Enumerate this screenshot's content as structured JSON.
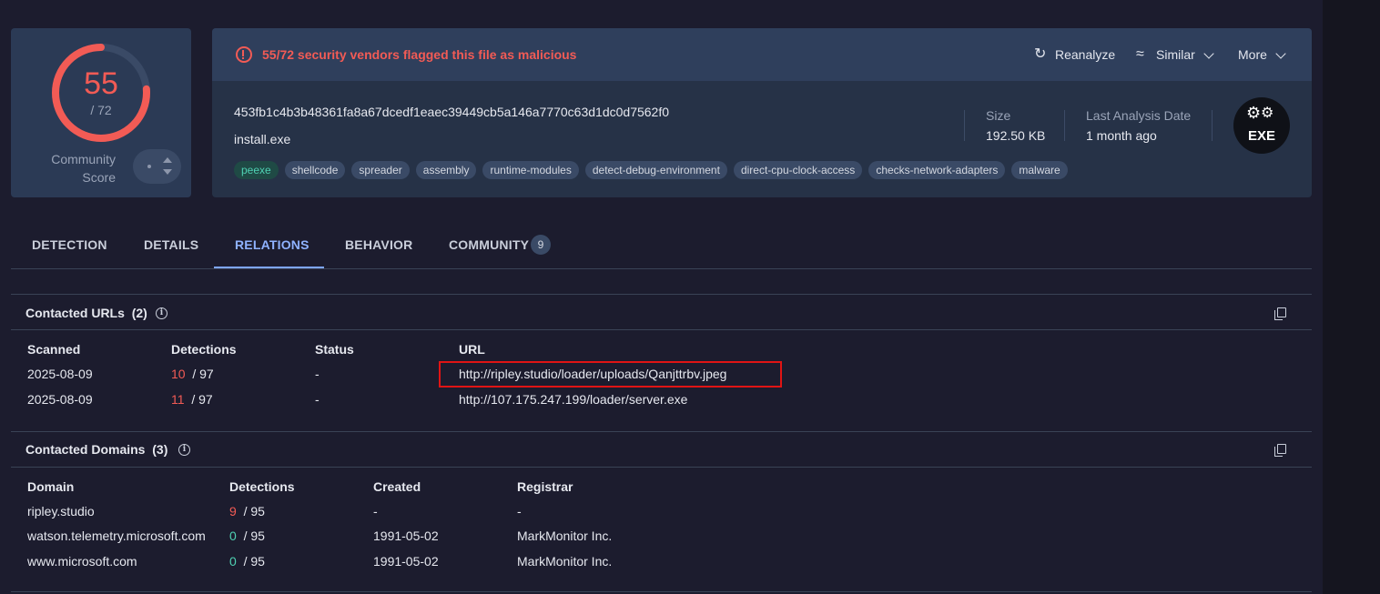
{
  "score": {
    "value": "55",
    "total": "/ 72",
    "fraction": 0.764,
    "community_label_line1": "Community",
    "community_label_line2": "Score",
    "vote_value": "-"
  },
  "alert": {
    "icon": "alert-circle-icon",
    "text": "55/72 security vendors flagged this file as malicious"
  },
  "actions": {
    "reanalyze": "Reanalyze",
    "similar": "Similar",
    "more": "More"
  },
  "file": {
    "hash": "453fb1c4b3b48361fa8a67dcedf1eaec39449cb5a146a7770c63d1dc0d7562f0",
    "name": "install.exe",
    "tags": [
      "peexe",
      "shellcode",
      "spreader",
      "assembly",
      "runtime-modules",
      "detect-debug-environment",
      "direct-cpu-clock-access",
      "checks-network-adapters",
      "malware"
    ],
    "size_label": "Size",
    "size_value": "192.50 KB",
    "date_label": "Last Analysis Date",
    "date_value": "1 month ago",
    "type_badge": "EXE"
  },
  "tabs": [
    {
      "label": "DETECTION",
      "active": false
    },
    {
      "label": "DETAILS",
      "active": false
    },
    {
      "label": "RELATIONS",
      "active": true
    },
    {
      "label": "BEHAVIOR",
      "active": false
    },
    {
      "label": "COMMUNITY",
      "active": false,
      "badge": "9"
    }
  ],
  "contacted_urls": {
    "title": "Contacted URLs",
    "count": "(2)",
    "headers": [
      "Scanned",
      "Detections",
      "Status",
      "URL"
    ],
    "rows": [
      {
        "scanned": "2025-08-09",
        "det": "10",
        "det_total": "/ 97",
        "status": "-",
        "url": "http://ripley.studio/loader/uploads/Qanjttrbv.jpeg"
      },
      {
        "scanned": "2025-08-09",
        "det": "11",
        "det_total": "/ 97",
        "status": "-",
        "url": "http://107.175.247.199/loader/server.exe"
      }
    ]
  },
  "contacted_domains": {
    "title": "Contacted Domains",
    "count": "(3)",
    "headers": [
      "Domain",
      "Detections",
      "Created",
      "Registrar"
    ],
    "rows": [
      {
        "domain": "ripley.studio",
        "det": "9",
        "det_total": "/ 95",
        "created": "-",
        "registrar": "-"
      },
      {
        "domain": "watson.telemetry.microsoft.com",
        "det": "0",
        "det_total": "/ 95",
        "created": "1991-05-02",
        "registrar": "MarkMonitor Inc."
      },
      {
        "domain": "www.microsoft.com",
        "det": "0",
        "det_total": "/ 95",
        "created": "1991-05-02",
        "registrar": "MarkMonitor Inc."
      }
    ]
  },
  "colors": {
    "malicious": "#f25b55",
    "clean": "#4fd1b3",
    "accent": "#7ea6ff",
    "highlight_box": "#e01414"
  }
}
